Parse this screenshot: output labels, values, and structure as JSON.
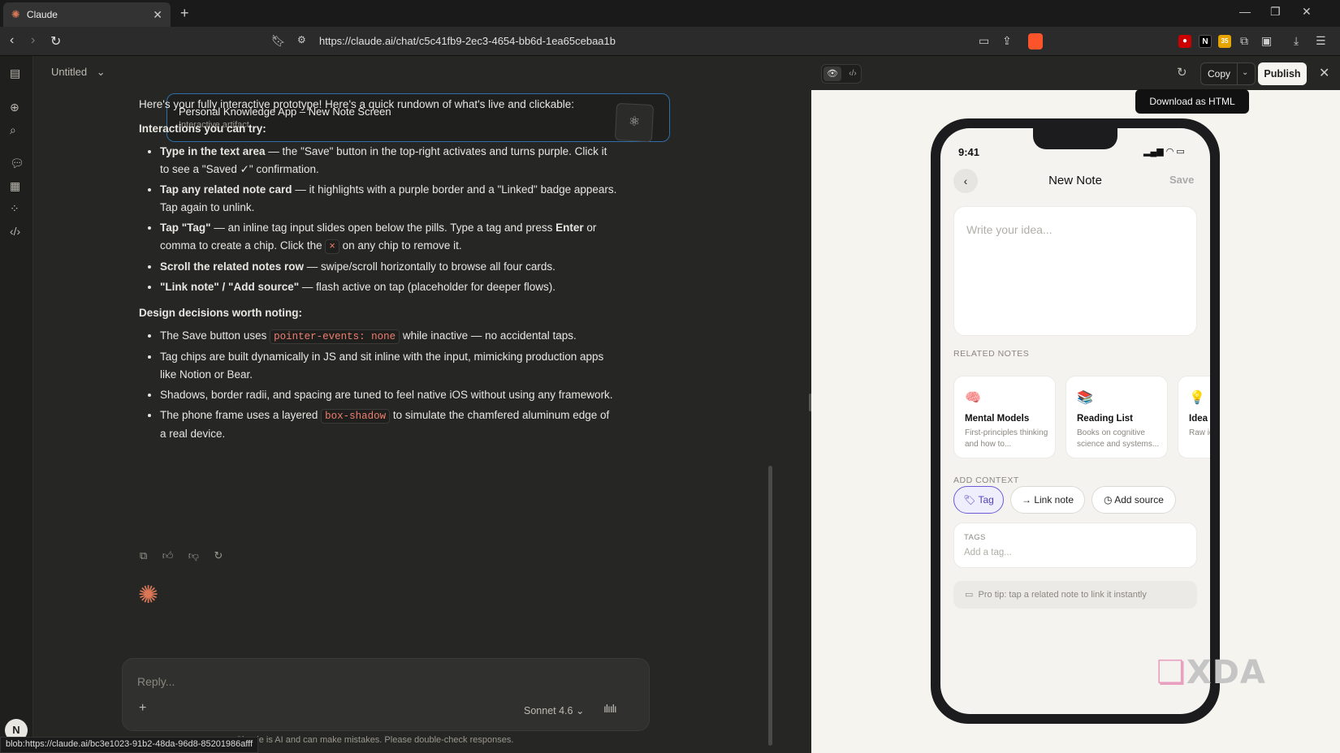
{
  "browser": {
    "tab_title": "Claude",
    "url": "https://claude.ai/chat/c5c41fb9-2ec3-4654-bb6d-1ea65cebaa1b",
    "status_url": "blob:https://claude.ai/bc3e1023-91b2-48da-96d8-85201986afff",
    "ext_badge": "35"
  },
  "chat": {
    "doc_title": "Untitled",
    "artifact": {
      "name": "Personal Knowledge App – New Note Screen",
      "subtitle": "Interactive artifact"
    },
    "intro": "Here's your fully interactive prototype! Here's a quick rundown of what's live and clickable:",
    "section1_title": "Interactions you can try:",
    "section1": [
      {
        "b": "Type in the text area",
        "t": " — the \"Save\" button in the top-right activates and turns purple. Click it to see a \"Saved ✓\" confirmation."
      },
      {
        "b": "Tap any related note card",
        "t": " — it highlights with a purple border and a \"Linked\" badge appears. Tap again to unlink."
      },
      {
        "b": "Tap \"Tag\"",
        "t": " — an inline tag input slides open below the pills. Type a tag and press ",
        "b2": "Enter",
        "t2": " or comma to create a chip. Click the ",
        "code": "×",
        "t3": " on any chip to remove it."
      },
      {
        "b": "Scroll the related notes row",
        "t": " — swipe/scroll horizontally to browse all four cards."
      },
      {
        "b": "\"Link note\" / \"Add source\"",
        "t": " — flash active on tap (placeholder for deeper flows)."
      }
    ],
    "section2_title": "Design decisions worth noting:",
    "section2": [
      {
        "t": "The Save button uses ",
        "code": "pointer-events: none",
        "t2": " while inactive — no accidental taps."
      },
      {
        "t": "Tag chips are built dynamically in JS and sit inline with the input, mimicking production apps like Notion or Bear."
      },
      {
        "t": "Shadows, border radii, and spacing are tuned to feel native iOS without using any framework."
      },
      {
        "t": "The phone frame uses a layered ",
        "code": "box-shadow",
        "t2": " to simulate the chamfered aluminum edge of a real device."
      }
    ],
    "composer": {
      "placeholder": "Reply...",
      "model": "Sonnet 4.6"
    },
    "disclaimer": "Claude is AI and can make mistakes. Please double-check responses.",
    "avatar": "N"
  },
  "preview": {
    "copy_label": "Copy",
    "publish_label": "Publish",
    "tooltip": "Download as HTML",
    "phone": {
      "time": "9:41",
      "title": "New Note",
      "save": "Save",
      "editor_placeholder": "Write your idea...",
      "related_label": "RELATED NOTES",
      "cards": [
        {
          "emoji": "🧠",
          "title": "Mental Models",
          "desc": "First-principles thinking and how to..."
        },
        {
          "emoji": "📚",
          "title": "Reading List",
          "desc": "Books on cognitive science and systems..."
        },
        {
          "emoji": "💡",
          "title": "Idea I",
          "desc": "Raw id during"
        }
      ],
      "context_label": "ADD CONTEXT",
      "chips": [
        "Tag",
        "Link note",
        "Add source"
      ],
      "tags_label": "TAGS",
      "tags_placeholder": "Add a tag...",
      "tip": "Pro tip: tap a related note to link it instantly"
    },
    "watermark": "XDA"
  }
}
